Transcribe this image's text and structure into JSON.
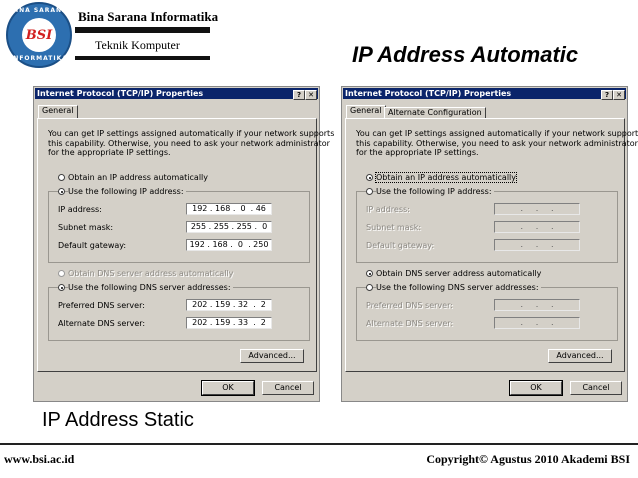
{
  "header": {
    "logo_text": "BSI",
    "logo_ring_top": "BINA SARANA",
    "logo_ring_bottom": "INFORMATIKA",
    "org_name": "Bina Sarana Informatika",
    "subtitle": "Teknik Komputer"
  },
  "slide": {
    "title_right": "IP Address Automatic",
    "title_left": "IP Address Static"
  },
  "footer": {
    "website": "www.bsi.ac.id",
    "copyright": "Copyright©  Agustus 2010 Akademi BSI"
  },
  "dialog_static": {
    "title": "Internet Protocol (TCP/IP) Properties",
    "help_btn": "?",
    "close_btn": "✕",
    "tabs": [
      "General"
    ],
    "description": "You can get IP settings assigned automatically if your network supports\nthis capability. Otherwise, you need to ask your network administrator\nfor the appropriate IP settings.",
    "radio_auto_ip": "Obtain an IP address automatically",
    "radio_manual_ip": "Use the following IP address:",
    "fields": [
      {
        "label": "IP address:",
        "value": "192 . 168 .  0  . 46"
      },
      {
        "label": "Subnet mask:",
        "value": "255 . 255 . 255 .  0"
      },
      {
        "label": "Default gateway:",
        "value": "192 . 168 .  0  . 250"
      }
    ],
    "radio_auto_dns": "Obtain DNS server address automatically",
    "radio_manual_dns": "Use the following DNS server addresses:",
    "dns_fields": [
      {
        "label": "Preferred DNS server:",
        "value": "202 . 159 . 32  .  2"
      },
      {
        "label": "Alternate DNS server:",
        "value": "202 . 159 . 33  .  2"
      }
    ],
    "advanced": "Advanced...",
    "ok": "OK",
    "cancel": "Cancel"
  },
  "dialog_auto": {
    "title": "Internet Protocol (TCP/IP) Properties",
    "help_btn": "?",
    "close_btn": "✕",
    "tabs": [
      "General",
      "Alternate Configuration"
    ],
    "description": "You can get IP settings assigned automatically if your network supports\nthis capability. Otherwise, you need to ask your network administrator\nfor the appropriate IP settings.",
    "radio_auto_ip": "Obtain an IP address automatically",
    "radio_manual_ip": "Use the following IP address:",
    "fields": [
      {
        "label": "IP address:",
        "value": "   .     .     .   "
      },
      {
        "label": "Subnet mask:",
        "value": "   .     .     .   "
      },
      {
        "label": "Default gateway:",
        "value": "   .     .     .   "
      }
    ],
    "radio_auto_dns": "Obtain DNS server address automatically",
    "radio_manual_dns": "Use the following DNS server addresses:",
    "dns_fields": [
      {
        "label": "Preferred DNS server:",
        "value": "   .     .     .   "
      },
      {
        "label": "Alternate DNS server:",
        "value": "   .     .     .   "
      }
    ],
    "advanced": "Advanced...",
    "ok": "OK",
    "cancel": "Cancel"
  }
}
